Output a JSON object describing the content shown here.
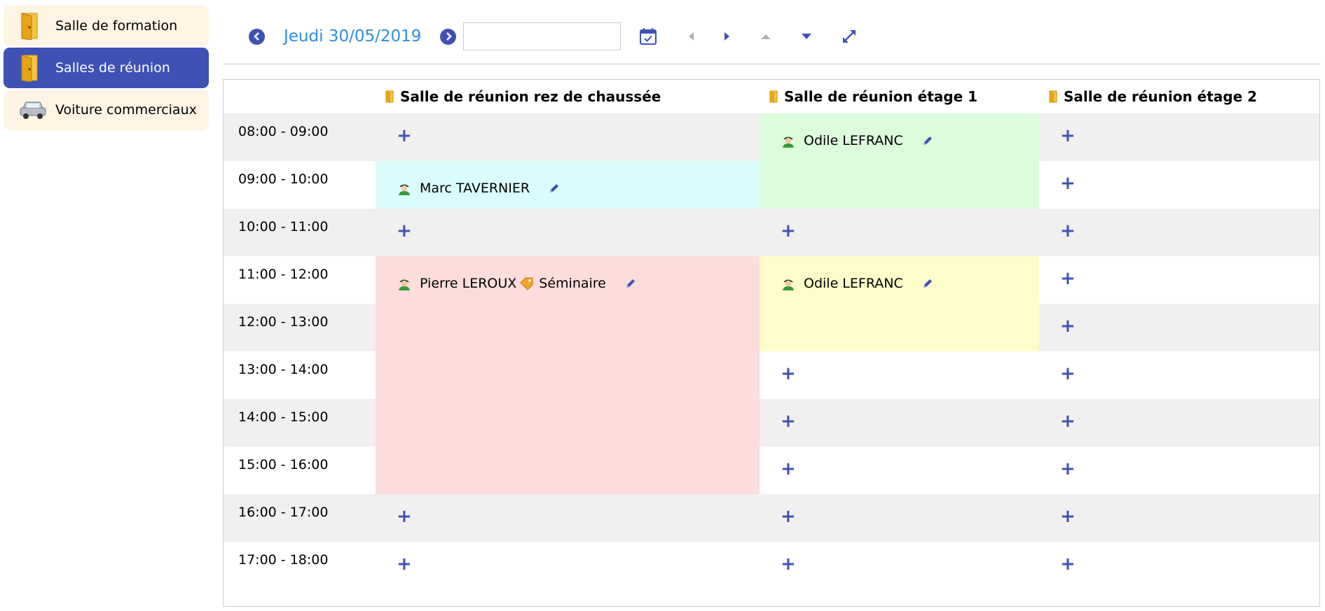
{
  "sidebar": {
    "items": [
      {
        "label": "Salle de formation",
        "icon": "door-icon"
      },
      {
        "label": "Salles de réunion",
        "icon": "door-icon",
        "active": true
      },
      {
        "label": "Voiture commerciaux",
        "icon": "car-icon"
      }
    ]
  },
  "toolbar": {
    "date_label": "Jeudi 30/05/2019",
    "date_input_value": ""
  },
  "grid": {
    "rooms": [
      "Salle de réunion rez de chaussée",
      "Salle de réunion étage 1",
      "Salle de réunion étage 2"
    ],
    "slots": [
      "08:00 - 09:00",
      "09:00 - 10:00",
      "10:00 - 11:00",
      "11:00 - 12:00",
      "12:00 - 13:00",
      "13:00 - 14:00",
      "14:00 - 15:00",
      "15:00 - 16:00",
      "16:00 - 17:00",
      "17:00 - 18:00"
    ],
    "add_symbol": "+",
    "reservations": [
      {
        "name": "Marc TAVERNIER",
        "room": 0,
        "start": "09:00",
        "end": "10:00",
        "color": "#dbfcfc"
      },
      {
        "name": "Pierre LEROUX",
        "label": "Séminaire",
        "room": 0,
        "start": "11:00",
        "end": "16:00",
        "color": "#fddcdc"
      },
      {
        "name": "Odile LEFRANC",
        "room": 1,
        "start": "08:00",
        "end": "10:00",
        "color": "#dcfcdc"
      },
      {
        "name": "Odile LEFRANC",
        "room": 1,
        "start": "11:00",
        "end": "13:00",
        "color": "#fdfdca"
      }
    ]
  },
  "colors": {
    "accent": "#3f51b5",
    "date_link": "#2f8ee0",
    "sidebar_bg": "#fdf4e3",
    "row_alt": "#f0f0f0"
  }
}
